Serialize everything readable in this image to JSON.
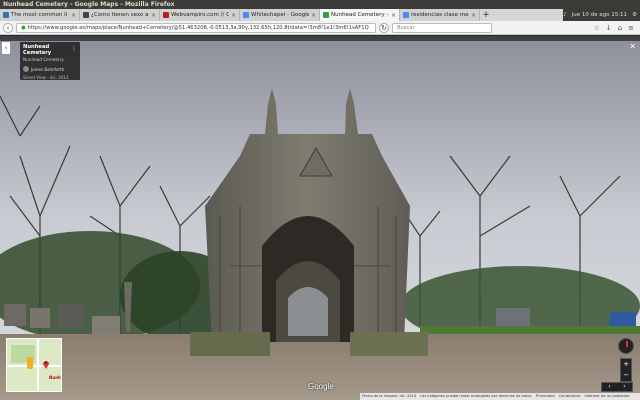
{
  "window": {
    "title": "Nunhead Cemetery - Google Maps - Mozilla Firefox"
  },
  "tabs": [
    {
      "label": "The most common li",
      "color": "#3b6fb5",
      "active": false
    },
    {
      "label": "¿Como tienen sexo ac",
      "color": "#444444",
      "active": false
    },
    {
      "label": "Webvampiro.com // C",
      "color": "#b02020",
      "active": false
    },
    {
      "label": "Whitechapel - Google",
      "color": "#4a8af4",
      "active": false
    },
    {
      "label": "Nunhead Cemetery - G",
      "color": "#2f9e44",
      "active": true
    },
    {
      "label": "residencias clase med",
      "color": "#4a8af4",
      "active": false
    }
  ],
  "system": {
    "datetime": "jue 10 de ago 15:11"
  },
  "nav": {
    "url": "https://www.google.es/maps/place/Nunhead+Cemetery/@51.463208,-0.0513,3a,90y,132.65h,120.8t/data=!3m8!1e1!3m6!1sAF1Q",
    "search_placeholder": "Buscar"
  },
  "streetview": {
    "place_title": "Nunhead Cemetery",
    "place_subtitle": "Nunhead Cemetery",
    "author": "James Balmforth",
    "date": "Street View - dic. 2014",
    "minimap_label": "Nunh",
    "logo": "Google",
    "footer_items": [
      "Fecha de la imagen: dic. 2014",
      "Las imágenes pueden estar protegidas por derechos de autor.",
      "Privacidad",
      "Condiciones",
      "Informar de un problema"
    ]
  },
  "icons": [
    "back-arrow-icon",
    "close-icon",
    "more-icon",
    "compass-icon",
    "zoom-in-icon",
    "zoom-out-icon",
    "pegman-icon",
    "map-pin-icon",
    "lock-icon"
  ]
}
